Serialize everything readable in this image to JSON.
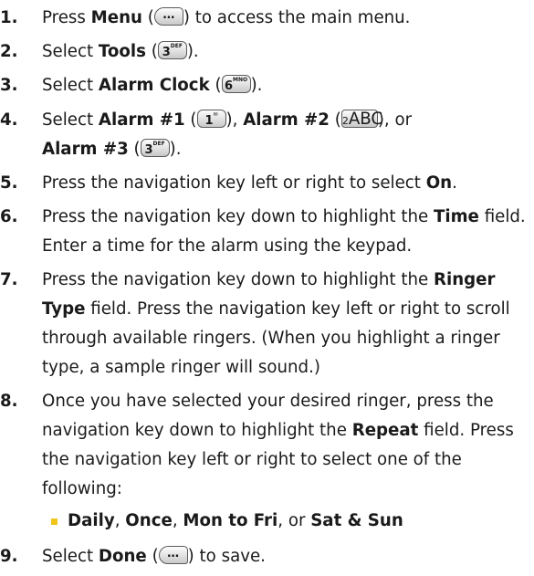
{
  "keys": {
    "menu": "…",
    "k1": "1",
    "k2": "2",
    "k2_letters": "ABC",
    "k3": "3",
    "k3_letters": "DEF",
    "k6": "6",
    "k6_letters": "MNO"
  },
  "steps": [
    {
      "num": "1.",
      "parts": [
        "Press ",
        "Menu",
        " (",
        ") to access the main menu."
      ]
    },
    {
      "num": "2.",
      "parts": [
        "Select ",
        "Tools",
        " (",
        ")."
      ]
    },
    {
      "num": "3.",
      "parts": [
        "Select ",
        "Alarm Clock",
        " (",
        ")."
      ]
    },
    {
      "num": "4.",
      "parts": [
        "Select ",
        "Alarm #1",
        " (",
        "), ",
        "Alarm #2",
        " (",
        "), or",
        "Alarm #3",
        " (",
        ")."
      ]
    },
    {
      "num": "5.",
      "parts": [
        "Press the navigation key left or right to select ",
        "On",
        "."
      ]
    },
    {
      "num": "6.",
      "parts": [
        "Press the navigation key down to highlight the ",
        "Time",
        " field. Enter a time for the alarm using the keypad."
      ]
    },
    {
      "num": "7.",
      "parts": [
        "Press the navigation key down to highlight the ",
        "Ringer Type",
        " field. Press the navigation key left or right to scroll through available ringers. (When you highlight a ringer type, a sample ringer will sound.)"
      ]
    },
    {
      "num": "8.",
      "parts": [
        "Once you have selected your desired ringer, press the navigation key down to highlight the ",
        "Repeat",
        " field. Press the navigation key left or right to select one of the following:"
      ]
    },
    {
      "num": "9.",
      "parts": [
        "Select ",
        "Done",
        " (",
        ") to save."
      ]
    }
  ],
  "bullet": {
    "parts": [
      "Daily",
      ", ",
      "Once",
      ", ",
      "Mon to Fri",
      ", or ",
      "Sat & Sun"
    ]
  }
}
